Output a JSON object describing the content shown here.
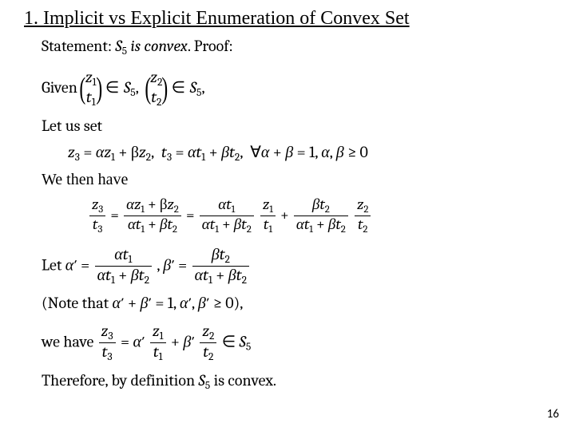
{
  "title": "1. Implicit vs Explicit Enumeration of Convex Set",
  "statement_label": "Statement: ",
  "statement_math": "S₅ is convex",
  "proof_label": ". Proof:",
  "given_label": "Given ",
  "let_us_set": "Let us set",
  "z3_def": "z₃ = αz₁ + βz₂",
  "t3_def": "t₃ = αt₁ + βt₂",
  "forall": "∀α + β = 1, α, β ≥ 0",
  "we_then_have": "We then have",
  "let_label": "Let ",
  "note_label": "(Note that ",
  "note_cond": "α′ + β′ = 1, α′, β′ ≥ 0",
  "note_close": "),",
  "we_have_label": "we have ",
  "in_S5": " ∈ S₅",
  "therefore": "Therefore, by definition ",
  "therefore_end": " is convex.",
  "page_number": "16",
  "chart_data": {
    "type": "table",
    "title": "Proof that S_5 is convex",
    "statements": [
      "Statement: S_5 is convex. Proof:",
      "Given (z_1/t_1) ∈ S_5, (z_2/t_2) ∈ S_5,",
      "Let us set",
      "z_3 = α z_1 + β z_2, t_3 = α t_1 + β t_2, ∀ α + β = 1, α, β ≥ 0",
      "We then have",
      "z_3 / t_3 = (α z_1 + β z_2)/(α t_1 + β t_2) = (α t_1)/(α t_1 + β t_2) · z_1/t_1 + (β t_2)/(α t_1 + β t_2) · z_2/t_2",
      "Let α' = (α t_1)/(α t_1 + β t_2), β' = (β t_2)/(α t_1 + β t_2)",
      "(Note that α' + β' = 1, α', β' ≥ 0),",
      "we have z_3/t_3 = α' z_1/t_1 + β' z_2/t_2 ∈ S_5",
      "Therefore, by definition S_5 is convex."
    ]
  }
}
